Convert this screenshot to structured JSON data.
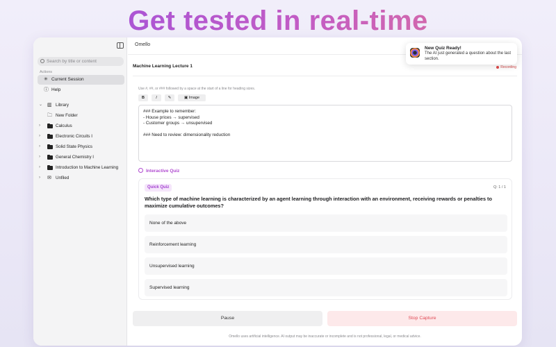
{
  "headline": "Get tested in real-time",
  "app": {
    "name": "Omello"
  },
  "sidebar": {
    "search_placeholder": "Search by title or content",
    "actions_label": "Actions",
    "actions": [
      {
        "label": "Current Session",
        "icon": "sparkle-icon",
        "active": true
      },
      {
        "label": "Help",
        "icon": "help-icon",
        "active": false
      }
    ],
    "library": {
      "label": "Library",
      "new_folder": "New Folder",
      "folders": [
        "Calculus",
        "Electronic Circuits I",
        "Solid State Physics",
        "General Chemistry I",
        "Introduction to Machine Learning"
      ],
      "unfiled": "Unfiled"
    }
  },
  "document": {
    "title": "Machine Learning Lecture 1",
    "status": "Recording",
    "hint": "Use #, ##, or ### followed by a space at the start of a line for heading sizes.",
    "toolbar": {
      "bold": "B",
      "italic": "I",
      "image": "Image"
    },
    "editor_lines": [
      "### Example to remember:",
      "- House prices → supervised",
      "- Customer groups → unsupervised",
      "",
      "### Need to review: dimensionality reduction"
    ]
  },
  "quiz": {
    "heading": "Interactive Quiz",
    "badge": "Quick Quiz",
    "counter": "Q: 1 / 1",
    "question": "Which type of machine learning is characterized by an agent learning through interaction with an environment, receiving rewards or penalties to maximize cumulative outcomes?",
    "options": [
      "None of the above",
      "Reinforcement learning",
      "Unsupervised learning",
      "Supervised learning"
    ]
  },
  "controls": {
    "pause": "Pause",
    "stop": "Stop Capture"
  },
  "disclaimer": "Omello uses artificial intelligence. AI output may be inaccurate or incomplete and is not professional, legal, or medical advice.",
  "notification": {
    "title": "New Quiz Ready!",
    "body": "The AI just generated a question about the last section."
  },
  "colors": {
    "accent": "#b04ad0",
    "stop": "#e04a55",
    "recording": "#e04a4a"
  }
}
